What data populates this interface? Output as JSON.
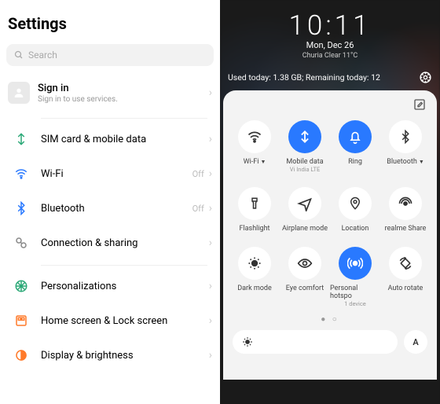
{
  "left": {
    "title": "Settings",
    "search_placeholder": "Search",
    "signin": {
      "title": "Sign in",
      "subtitle": "Sign in to use services."
    },
    "items": [
      {
        "label": "SIM card & mobile data",
        "value": ""
      },
      {
        "label": "Wi-Fi",
        "value": "Off"
      },
      {
        "label": "Bluetooth",
        "value": "Off"
      },
      {
        "label": "Connection & sharing",
        "value": ""
      }
    ],
    "items2": [
      {
        "label": "Personalizations"
      },
      {
        "label": "Home screen & Lock screen"
      },
      {
        "label": "Display & brightness"
      }
    ]
  },
  "right": {
    "clock": {
      "time": "10:11",
      "date": "Mon, Dec 26",
      "weather": "Churia Clear 11°C"
    },
    "data_usage": "Used today: 1.38 GB; Remaining today: 12",
    "tiles": [
      {
        "label": "Wi-Fi",
        "sub": "",
        "on": false,
        "dropdown": true
      },
      {
        "label": "Mobile data",
        "sub": "Vi India LTE",
        "on": true,
        "dropdown": false
      },
      {
        "label": "Ring",
        "sub": "",
        "on": true,
        "dropdown": false
      },
      {
        "label": "Bluetooth",
        "sub": "",
        "on": false,
        "dropdown": true
      },
      {
        "label": "Flashlight",
        "sub": "",
        "on": false,
        "dropdown": false
      },
      {
        "label": "Airplane mode",
        "sub": "",
        "on": false,
        "dropdown": false
      },
      {
        "label": "Location",
        "sub": "",
        "on": false,
        "dropdown": false
      },
      {
        "label": "realme Share",
        "sub": "",
        "on": false,
        "dropdown": false
      },
      {
        "label": "Dark mode",
        "sub": "",
        "on": false,
        "dropdown": false
      },
      {
        "label": "Eye comfort",
        "sub": "",
        "on": false,
        "dropdown": false
      },
      {
        "label": "Personal hotspo",
        "sub": "1 device",
        "on": true,
        "dropdown": false
      },
      {
        "label": "Auto rotate",
        "sub": "",
        "on": false,
        "dropdown": false
      }
    ],
    "auto_brightness": "A"
  }
}
